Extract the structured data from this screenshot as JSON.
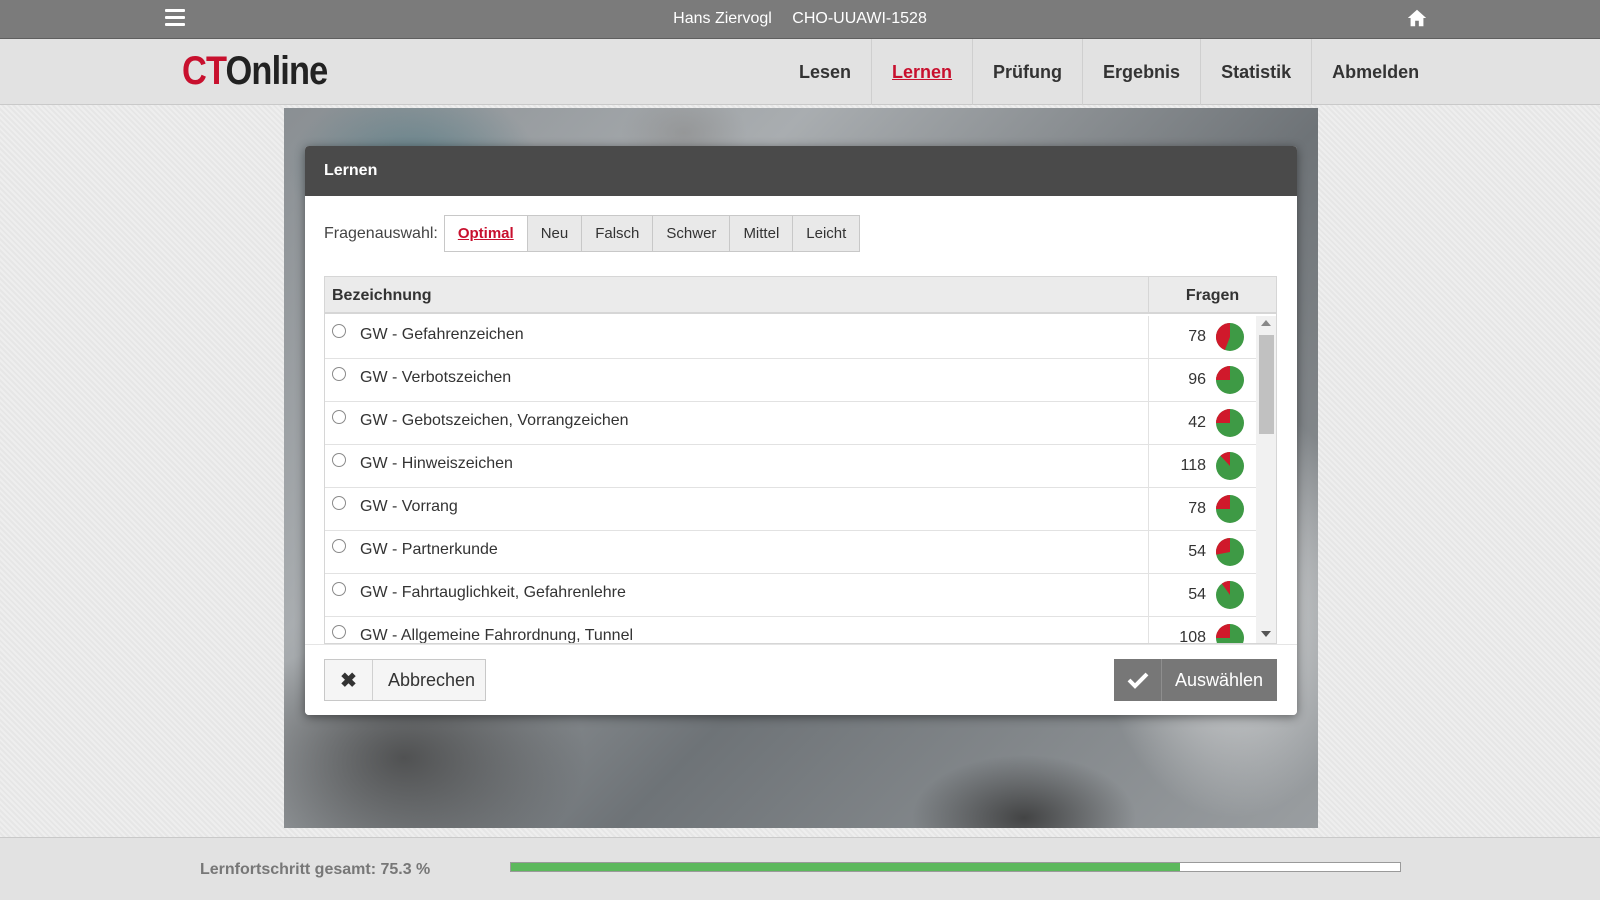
{
  "topbar": {
    "user_name": "Hans Ziervogl",
    "device_id": "CHO-UUAWI-1528",
    "menu_icon": "hamburger-menu-icon",
    "home_icon": "home-icon"
  },
  "header": {
    "logo_ct": "CT",
    "logo_online": "Online",
    "nav": [
      {
        "label": "Lesen",
        "active": false
      },
      {
        "label": "Lernen",
        "active": true
      },
      {
        "label": "Prüfung",
        "active": false
      },
      {
        "label": "Ergebnis",
        "active": false
      },
      {
        "label": "Statistik",
        "active": false
      },
      {
        "label": "Abmelden",
        "active": false
      }
    ]
  },
  "dialog": {
    "title": "Lernen",
    "filter_label": "Fragenauswahl:",
    "filters": [
      "Optimal",
      "Neu",
      "Falsch",
      "Schwer",
      "Mittel",
      "Leicht"
    ],
    "active_filter": "Optimal",
    "table": {
      "col_name": "Bezeichnung",
      "col_fragen": "Fragen",
      "rows": [
        {
          "label": "GW - Gefahrenzeichen",
          "count": "78",
          "progress": 0.56
        },
        {
          "label": "GW - Verbotszeichen",
          "count": "96",
          "progress": 0.75
        },
        {
          "label": "GW - Gebotszeichen, Vorrangzeichen",
          "count": "42",
          "progress": 0.75
        },
        {
          "label": "GW - Hinweiszeichen",
          "count": "118",
          "progress": 0.88
        },
        {
          "label": "GW - Vorrang",
          "count": "78",
          "progress": 0.75
        },
        {
          "label": "GW - Partnerkunde",
          "count": "54",
          "progress": 0.72
        },
        {
          "label": "GW - Fahrtauglichkeit, Gefahrenlehre",
          "count": "54",
          "progress": 0.9
        },
        {
          "label": "GW - Allgemeine Fahrordnung, Tunnel",
          "count": "108",
          "progress": 0.75
        }
      ]
    },
    "cancel_label": "Abbrechen",
    "select_label": "Auswählen"
  },
  "footer": {
    "progress_label": "Lernfortschritt gesamt: 75.3 %",
    "progress_value": 0.753
  },
  "colors": {
    "accent": "#c8102e",
    "pie_done": "#3e9a45",
    "pie_open": "#d0192b",
    "progress": "#5cb85c"
  }
}
